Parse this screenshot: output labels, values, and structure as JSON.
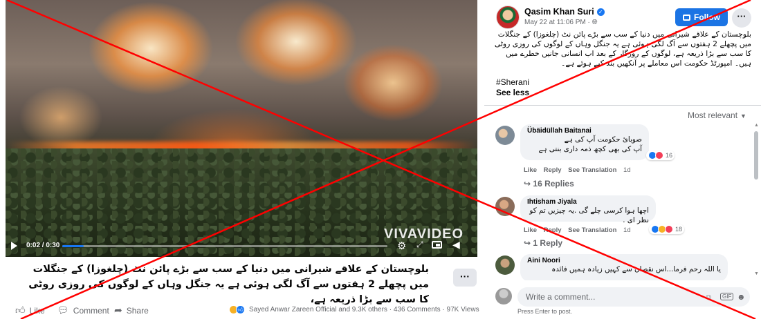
{
  "video": {
    "watermark": "VIVAVIDEO",
    "time": "0:02 / 0:30",
    "progress": 0.067
  },
  "caption": {
    "text": "بلوچستان کے علاقے شیرانی میں دنیا کے سب سے بڑے پائن نٹ (چلغوزا) کے جنگلات میں پچھلے 2 ہفتوں سے آگ لگی ہوئی ہے یہ جنگل وہاں کے لوگوں کی روزی روٹی کا سب سے بڑا ذریعہ ہے،",
    "more_label": "···"
  },
  "actions": {
    "like": "Like",
    "comment": "Comment",
    "share": "Share",
    "summary": "Sayed Anwar Zareen Official and 9.3K others · 436 Comments · 97K Views"
  },
  "post": {
    "author": "Qasim Khan Suri",
    "time": "May 22 at 11:06 PM · ",
    "follow_label": "Follow",
    "more_label": "···",
    "body": "بلوچستان کے علاقے شیرانی میں دنیا کے سب سے بڑے پائن نٹ (چلغوزا) کے جنگلات میں پچھلے 2 ہفتوں سے آگ لگی ہوئی ہے یہ جنگل وہاں کے لوگوں کی روزی روٹی کا سب سے بڑا ذریعہ ہے، لوگوں کے روزگار کے بعد اب انسانی جانیں خطرے میں ہیں۔ امپورٹڈ حکومت اس معاملے پر آنکھیں بند کیے ہوئے ہے۔",
    "hashtag": "#Sherani",
    "see_less": "See less",
    "sort_label": "Most relevant"
  },
  "comments": [
    {
      "name": "Übäidüllah Baitanai",
      "lines": [
        "صوبائ حکومت آپ کی ہے",
        "آپ کی بھی کچھ ذمہ داری بنتی ہے"
      ],
      "like": "Like",
      "reply": "Reply",
      "translate": "See Translation",
      "age": "1d",
      "reaction_count": "16",
      "replies": "16 Replies"
    },
    {
      "name": "Ihtisham Jiyala",
      "lines": [
        "اچھا ہوا کرسی چلے گی .یہ چیزیں تم کو نظر ای ."
      ],
      "like": "Like",
      "reply": "Reply",
      "translate": "See Translation",
      "age": "1d",
      "reaction_count": "18",
      "replies": "1 Reply"
    },
    {
      "name": "Aini Noori",
      "lines": [
        "یا اللہ رحم فرما...اس نقصان سے کہیں زیادہ ہمیں فائدہ"
      ]
    }
  ],
  "composer": {
    "placeholder": "Write a comment...",
    "hint": "Press Enter to post."
  },
  "colors": {
    "accent": "#1877f2",
    "overlay_x": "#ff0000"
  }
}
